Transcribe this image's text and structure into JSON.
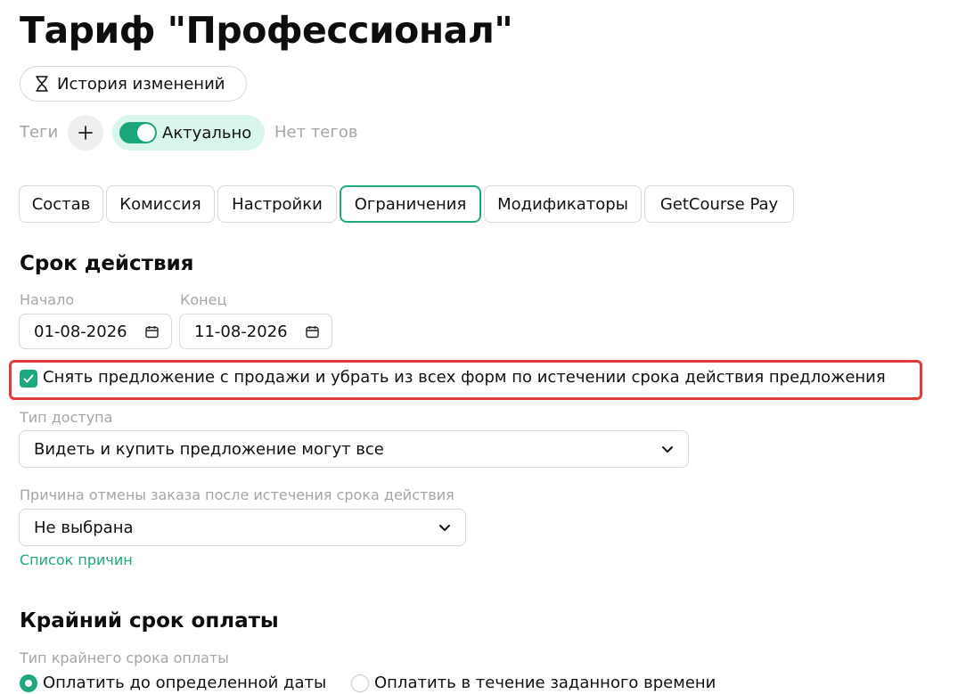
{
  "page_title": "Тариф \"Профессионал\"",
  "history_button": {
    "label": "История изменений"
  },
  "tags": {
    "label": "Теги",
    "status_label": "Актуально",
    "status_on": true,
    "empty_text": "Нет тегов"
  },
  "tabs": [
    {
      "label": "Состав"
    },
    {
      "label": "Комиссия"
    },
    {
      "label": "Настройки"
    },
    {
      "label": "Ограничения",
      "active": true
    },
    {
      "label": "Модификаторы"
    },
    {
      "label": "GetCourse Pay"
    }
  ],
  "validity": {
    "title": "Срок действия",
    "start_label": "Начало",
    "start_value": "01-08-2026",
    "end_label": "Конец",
    "end_value": "11-08-2026",
    "withdraw_checkbox_label": "Снять предложение с продажи и убрать из всех форм по истечении срока действия предложения",
    "withdraw_checked": true,
    "access_type_label": "Тип доступа",
    "access_type_value": "Видеть и купить предложение могут все",
    "cancel_reason_label": "Причина отмены заказа после истечения срока действия",
    "cancel_reason_value": "Не выбрана",
    "reasons_link": "Список причин"
  },
  "payment_deadline": {
    "title": "Крайний срок оплаты",
    "type_label": "Тип крайнего срока оплаты",
    "options": [
      {
        "label": "Оплатить до определенной даты",
        "selected": true
      },
      {
        "label": "Оплатить в течение заданного времени",
        "selected": false
      }
    ]
  },
  "colors": {
    "accent": "#1ea880",
    "highlight": "#e03c3c",
    "pill_bg": "#d8f6ec",
    "muted_text": "#a6a6a6"
  }
}
